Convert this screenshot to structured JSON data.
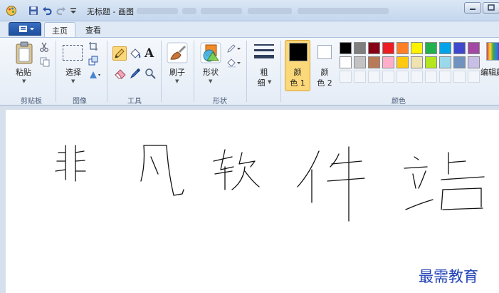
{
  "window": {
    "title": "无标题 - 画图"
  },
  "tabs": [
    {
      "label": "主页",
      "active": true
    },
    {
      "label": "查看",
      "active": false
    }
  ],
  "ribbon": {
    "clipboard": {
      "paste_label": "粘贴",
      "group_label": "剪贴板"
    },
    "image": {
      "select_label": "选择",
      "group_label": "图像"
    },
    "tools": {
      "group_label": "工具",
      "text_glyph": "A"
    },
    "brushes": {
      "label": "刷子"
    },
    "shapes": {
      "label": "形状",
      "group_label": "形状"
    },
    "size": {
      "label_line1": "粗",
      "label_line2": "细"
    },
    "color1": {
      "label_line1": "颜",
      "label_line2": "色 1",
      "value": "#000000"
    },
    "color2": {
      "label_line1": "颜",
      "label_line2": "色 2",
      "value": "#ffffff"
    },
    "colors": {
      "group_label": "颜色",
      "row1": [
        "#000000",
        "#7f7f7f",
        "#880015",
        "#ed1c24",
        "#ff7f27",
        "#fff200",
        "#22b14c",
        "#00a2e8",
        "#3f48cc",
        "#a349a4"
      ],
      "row2": [
        "#ffffff",
        "#c3c3c3",
        "#b97a57",
        "#ffaec9",
        "#ffc90e",
        "#efe4b0",
        "#b5e61d",
        "#99d9ea",
        "#7092be",
        "#c8bfe7"
      ],
      "custom_count": 10
    },
    "edit_colors": {
      "label": "编辑颜"
    }
  },
  "canvas": {
    "drawing": "非凡软件站",
    "watermark": "最需教育"
  }
}
